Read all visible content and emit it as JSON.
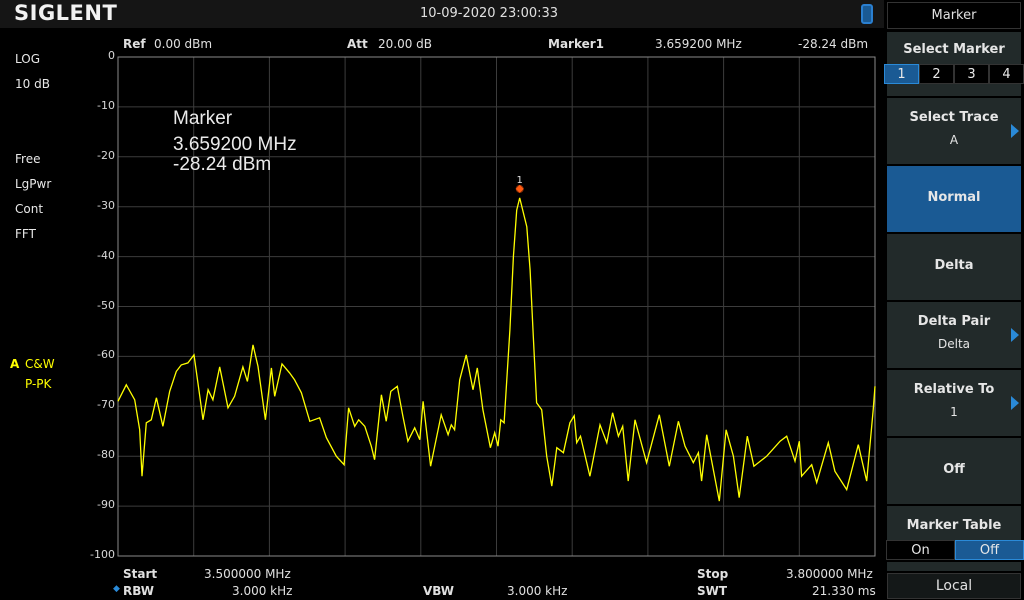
{
  "app": {
    "brand": "SIGLENT",
    "datetime": "10-09-2020   23:00:33"
  },
  "header": {
    "ref_label": "Ref",
    "ref_value": "0.00 dBm",
    "att_label": "Att",
    "att_value": "20.00 dB",
    "marker_label": "Marker1",
    "marker_freq": "3.659200 MHz",
    "marker_amp": "-28.24 dBm"
  },
  "left_status": {
    "scale_type": "LOG",
    "scale_div": "10 dB",
    "trigger": "Free",
    "detector_avg": "LgPwr",
    "sweep": "Cont",
    "mode": "FFT",
    "trace_id": "A",
    "trace_mode": "C&W",
    "trace_detector": "P-PK"
  },
  "marker_readout": {
    "title": "Marker",
    "freq": "3.659200 MHz",
    "amp": "-28.24 dBm",
    "marker_number": "1"
  },
  "footer": {
    "start_label": "Start",
    "start_value": "3.500000 MHz",
    "stop_label": "Stop",
    "stop_value": "3.800000 MHz",
    "rbw_label": "RBW",
    "rbw_value": "3.000 kHz",
    "vbw_label": "VBW",
    "vbw_value": "3.000 kHz",
    "swt_label": "SWT",
    "swt_value": "21.330 ms"
  },
  "panel": {
    "title": "Marker",
    "select_marker": {
      "label": "Select Marker",
      "options": [
        "1",
        "2",
        "3",
        "4"
      ],
      "selected": "1"
    },
    "select_trace": {
      "label": "Select Trace",
      "value": "A"
    },
    "normal": {
      "label": "Normal",
      "active": true
    },
    "delta": {
      "label": "Delta"
    },
    "delta_pair": {
      "label": "Delta Pair",
      "value": "Delta"
    },
    "relative_to": {
      "label": "Relative To",
      "value": "1"
    },
    "off": {
      "label": "Off"
    },
    "marker_table": {
      "label": "Marker Table",
      "options": [
        "On",
        "Off"
      ],
      "selected": "Off"
    },
    "local": "Local"
  },
  "colors": {
    "trace": "#ffff00",
    "accent": "#1a5a94",
    "marker": "#ff5a10",
    "grid": "#3c3c3c"
  },
  "chart_data": {
    "type": "line",
    "x_unit": "MHz",
    "y_unit": "dBm",
    "xlim": [
      3.5,
      3.8
    ],
    "ylim": [
      -100,
      0
    ],
    "y_ticks": [
      0,
      -10,
      -20,
      -30,
      -40,
      -50,
      -60,
      -70,
      -80,
      -90,
      -100
    ],
    "grid": true,
    "marker": {
      "x": 3.6592,
      "y": -28.24,
      "label": "1"
    },
    "points": [
      [
        3.5,
        -69.0
      ],
      [
        3.5033,
        -65.7
      ],
      [
        3.5066,
        -68.7
      ],
      [
        3.5086,
        -74.7
      ],
      [
        3.5095,
        -84.0
      ],
      [
        3.5112,
        -73.3
      ],
      [
        3.5132,
        -72.7
      ],
      [
        3.5152,
        -68.3
      ],
      [
        3.5178,
        -74.0
      ],
      [
        3.5205,
        -67.0
      ],
      [
        3.5231,
        -63.0
      ],
      [
        3.5251,
        -61.7
      ],
      [
        3.5277,
        -61.3
      ],
      [
        3.5301,
        -59.7
      ],
      [
        3.5324,
        -68.0
      ],
      [
        3.5337,
        -72.7
      ],
      [
        3.5357,
        -66.7
      ],
      [
        3.5376,
        -68.7
      ],
      [
        3.5403,
        -62.1
      ],
      [
        3.5436,
        -70.3
      ],
      [
        3.5462,
        -68.0
      ],
      [
        3.5495,
        -62.1
      ],
      [
        3.5513,
        -65.0
      ],
      [
        3.5535,
        -57.7
      ],
      [
        3.5555,
        -62.0
      ],
      [
        3.5584,
        -72.7
      ],
      [
        3.5608,
        -62.3
      ],
      [
        3.5621,
        -68.0
      ],
      [
        3.565,
        -61.5
      ],
      [
        3.568,
        -63.3
      ],
      [
        3.57,
        -64.7
      ],
      [
        3.5727,
        -67.3
      ],
      [
        3.576,
        -73.0
      ],
      [
        3.5799,
        -72.3
      ],
      [
        3.5826,
        -76.3
      ],
      [
        3.5865,
        -80.0
      ],
      [
        3.5896,
        -81.7
      ],
      [
        3.5914,
        -70.3
      ],
      [
        3.5938,
        -74.0
      ],
      [
        3.5954,
        -72.7
      ],
      [
        3.5978,
        -74.0
      ],
      [
        3.6004,
        -78.0
      ],
      [
        3.6017,
        -80.7
      ],
      [
        3.6044,
        -67.7
      ],
      [
        3.6063,
        -73.0
      ],
      [
        3.6081,
        -67.0
      ],
      [
        3.6107,
        -66.0
      ],
      [
        3.6129,
        -72.0
      ],
      [
        3.6149,
        -77.0
      ],
      [
        3.6176,
        -74.3
      ],
      [
        3.6196,
        -76.7
      ],
      [
        3.6209,
        -69.0
      ],
      [
        3.6239,
        -82.0
      ],
      [
        3.6281,
        -71.7
      ],
      [
        3.6308,
        -75.7
      ],
      [
        3.6321,
        -73.7
      ],
      [
        3.6334,
        -74.7
      ],
      [
        3.6354,
        -64.7
      ],
      [
        3.638,
        -59.7
      ],
      [
        3.6407,
        -66.7
      ],
      [
        3.6424,
        -62.3
      ],
      [
        3.6446,
        -70.7
      ],
      [
        3.6476,
        -78.3
      ],
      [
        3.6493,
        -75.3
      ],
      [
        3.6506,
        -78.0
      ],
      [
        3.6517,
        -72.7
      ],
      [
        3.653,
        -73.3
      ],
      [
        3.6553,
        -54.7
      ],
      [
        3.6567,
        -40.0
      ],
      [
        3.658,
        -30.7
      ],
      [
        3.6592,
        -28.24
      ],
      [
        3.662,
        -34.0
      ],
      [
        3.6633,
        -42.7
      ],
      [
        3.6646,
        -56.0
      ],
      [
        3.6659,
        -69.3
      ],
      [
        3.6679,
        -70.7
      ],
      [
        3.6699,
        -80.0
      ],
      [
        3.6719,
        -86.0
      ],
      [
        3.6739,
        -78.3
      ],
      [
        3.6765,
        -79.3
      ],
      [
        3.6791,
        -73.3
      ],
      [
        3.6808,
        -71.9
      ],
      [
        3.6818,
        -77.3
      ],
      [
        3.6833,
        -76.0
      ],
      [
        3.687,
        -84.0
      ],
      [
        3.691,
        -73.7
      ],
      [
        3.6937,
        -77.3
      ],
      [
        3.696,
        -71.3
      ],
      [
        3.6983,
        -76.0
      ],
      [
        3.7,
        -74.0
      ],
      [
        3.7022,
        -85.0
      ],
      [
        3.7049,
        -72.7
      ],
      [
        3.7095,
        -81.3
      ],
      [
        3.7145,
        -71.7
      ],
      [
        3.7185,
        -82.0
      ],
      [
        3.7221,
        -73.0
      ],
      [
        3.7247,
        -78.0
      ],
      [
        3.728,
        -81.3
      ],
      [
        3.73,
        -79.3
      ],
      [
        3.7313,
        -85.0
      ],
      [
        3.7333,
        -75.7
      ],
      [
        3.7383,
        -89.0
      ],
      [
        3.741,
        -74.7
      ],
      [
        3.7439,
        -80.0
      ],
      [
        3.7462,
        -88.3
      ],
      [
        3.7494,
        -76.0
      ],
      [
        3.752,
        -82.0
      ],
      [
        3.7571,
        -80.0
      ],
      [
        3.7624,
        -77.0
      ],
      [
        3.765,
        -76.0
      ],
      [
        3.7683,
        -81.0
      ],
      [
        3.77,
        -77.0
      ],
      [
        3.7709,
        -84.0
      ],
      [
        3.7749,
        -81.7
      ],
      [
        3.7769,
        -85.3
      ],
      [
        3.7815,
        -77.3
      ],
      [
        3.7841,
        -83.0
      ],
      [
        3.7888,
        -86.7
      ],
      [
        3.7934,
        -77.7
      ],
      [
        3.7967,
        -85.0
      ],
      [
        3.7993,
        -70.7
      ],
      [
        3.8,
        -66.0
      ]
    ]
  }
}
